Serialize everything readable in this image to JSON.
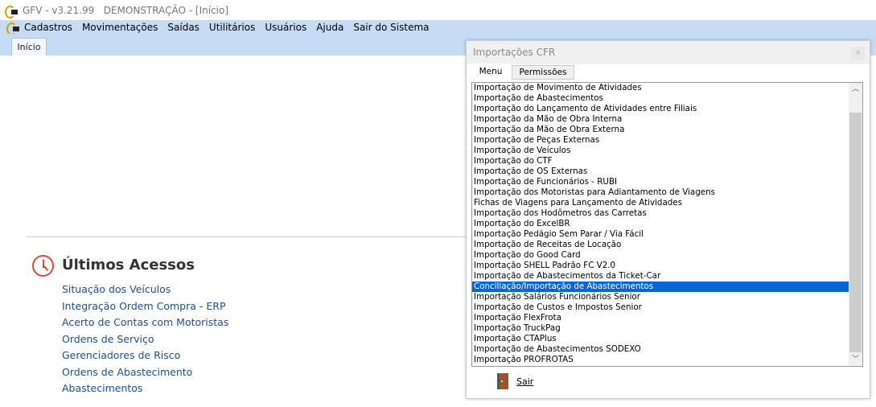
{
  "app": {
    "title": "GFV - v3.21.99   DEMONSTRAÇÃO - [Início]"
  },
  "menu": [
    "Cadastros",
    "Movimentações",
    "Saídas",
    "Utilitários",
    "Usuários",
    "Ajuda",
    "Sair do Sistema"
  ],
  "tabs": {
    "inicio": "Início"
  },
  "recent": {
    "title": "Últimos Acessos",
    "items": [
      "Situação dos Veículos",
      "Integração Ordem Compra - ERP",
      "Acerto de Contas com Motoristas",
      "Ordens de Serviço",
      "Gerenciadores de Risco",
      "Ordens de Abastecimento",
      "Abastecimentos"
    ]
  },
  "dialog": {
    "title": "Importações CFR",
    "close": "x",
    "tabs": [
      "Menu",
      "Permissões"
    ],
    "selected_index": 19,
    "items": [
      "Importação de Movimento de Atividades",
      "Importação de Abastecimentos",
      "Importação do Lançamento de Atividades entre Filiais",
      "Importação da Mão de Obra Interna",
      "Importação da Mão de Obra Externa",
      "Importação de Peças Externas",
      "Importação de Veículos",
      "Importação do CTF",
      "Importação de OS Externas",
      "Importação de Funcionários - RUBI",
      "Importação dos Motoristas para Adiantamento de Viagens",
      "Fichas de Viagens para Lançamento de Atividades",
      "Importação dos Hodômetros das Carretas",
      "Importação do ExcelBR",
      "Importação Pedágio Sem Parar / Via Fácil",
      "Importação de Receitas de Locação",
      "Importação do Good Card",
      "Importação SHELL Padrão FC V2.0",
      "Importação de Abastecimentos da Ticket-Car",
      "Conciliação/Importação de Abastecimentos",
      "Importação Salários Funcionários Senior",
      "Importação de Custos e Impostos Senior",
      "Importação FlexFrota",
      "Importação TruckPag",
      "Importação CTAPlus",
      "Importação de Abastecimentos SODEXO",
      "Importação PROFROTAS"
    ],
    "exit": "Sair"
  }
}
